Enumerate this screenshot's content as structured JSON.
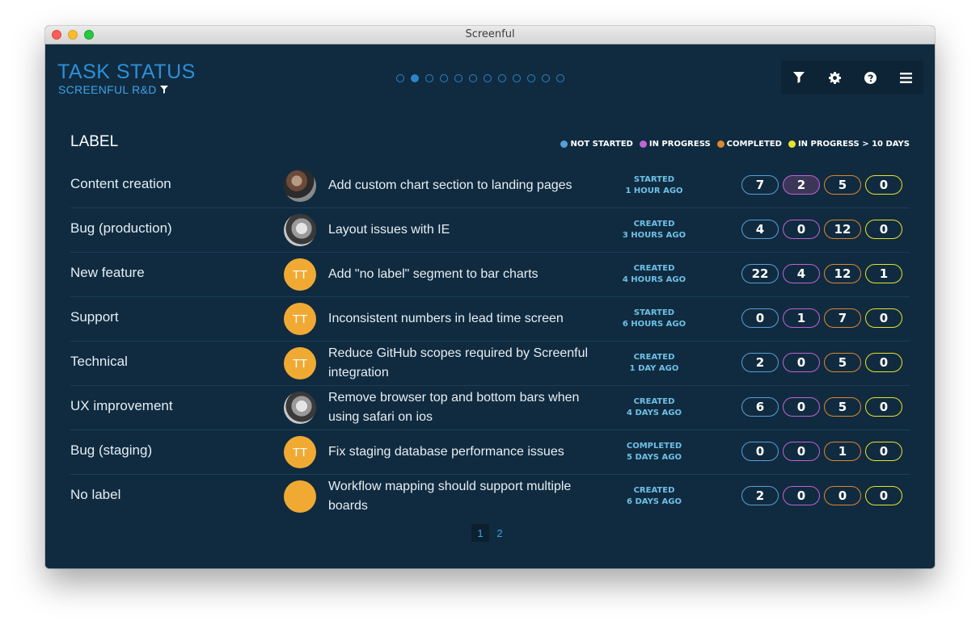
{
  "window": {
    "title": "Screenful"
  },
  "header": {
    "title": "TASK STATUS",
    "subtitle": "SCREENFUL R&D",
    "page_dots": {
      "total": 12,
      "active_index": 1
    }
  },
  "toolbar": {
    "buttons": [
      {
        "name": "filter",
        "icon": "filter-icon"
      },
      {
        "name": "settings",
        "icon": "gear-icon"
      },
      {
        "name": "help",
        "icon": "help-icon"
      },
      {
        "name": "menu",
        "icon": "hamburger-icon"
      }
    ]
  },
  "table": {
    "heading": "LABEL",
    "legend": [
      {
        "label": "NOT STARTED",
        "color": "#5a9ed6"
      },
      {
        "label": "IN PROGRESS",
        "color": "#c063d2"
      },
      {
        "label": "COMPLETED",
        "color": "#e1862b"
      },
      {
        "label": "IN PROGRESS > 10 DAYS",
        "color": "#e7e42a"
      }
    ],
    "rows": [
      {
        "label": "Content creation",
        "avatar": "",
        "avatar_style": "photo-a",
        "task": "Add custom chart section to landing pages",
        "status": "STARTED",
        "time": "1 HOUR AGO",
        "counts": [
          "7",
          "2",
          "5",
          "0"
        ],
        "highlight_in_progress": true
      },
      {
        "label": "Bug (production)",
        "avatar": "",
        "avatar_style": "photo-b",
        "task": "Layout issues with IE",
        "status": "CREATED",
        "time": "3 HOURS AGO",
        "counts": [
          "4",
          "0",
          "12",
          "0"
        ],
        "highlight_in_progress": false
      },
      {
        "label": "New feature",
        "avatar": "TT",
        "avatar_style": "initials",
        "task": "Add \"no label\" segment to bar charts",
        "status": "CREATED",
        "time": "4 HOURS AGO",
        "counts": [
          "22",
          "4",
          "12",
          "1"
        ],
        "highlight_in_progress": false
      },
      {
        "label": "Support",
        "avatar": "TT",
        "avatar_style": "initials",
        "task": "Inconsistent numbers in lead time screen",
        "status": "STARTED",
        "time": "6 HOURS AGO",
        "counts": [
          "0",
          "1",
          "7",
          "0"
        ],
        "highlight_in_progress": false
      },
      {
        "label": "Technical",
        "avatar": "TT",
        "avatar_style": "initials",
        "task": "Reduce GitHub scopes required by Screenful integration",
        "status": "CREATED",
        "time": "1 DAY AGO",
        "counts": [
          "2",
          "0",
          "5",
          "0"
        ],
        "highlight_in_progress": false
      },
      {
        "label": "UX improvement",
        "avatar": "",
        "avatar_style": "photo-b",
        "task": "Remove browser top and bottom bars when using safari on ios",
        "status": "CREATED",
        "time": "4 DAYS AGO",
        "counts": [
          "6",
          "0",
          "5",
          "0"
        ],
        "highlight_in_progress": false
      },
      {
        "label": "Bug (staging)",
        "avatar": "TT",
        "avatar_style": "initials",
        "task": "Fix staging database performance issues",
        "status": "COMPLETED",
        "time": "5 DAYS AGO",
        "counts": [
          "0",
          "0",
          "1",
          "0"
        ],
        "highlight_in_progress": false
      },
      {
        "label": "No label",
        "avatar": "",
        "avatar_style": "initials",
        "task": "Workflow mapping should support multiple boards",
        "status": "CREATED",
        "time": "6 DAYS AGO",
        "counts": [
          "2",
          "0",
          "0",
          "0"
        ],
        "highlight_in_progress": false
      }
    ]
  },
  "pagination": {
    "pages": [
      "1",
      "2"
    ],
    "active": "1"
  }
}
